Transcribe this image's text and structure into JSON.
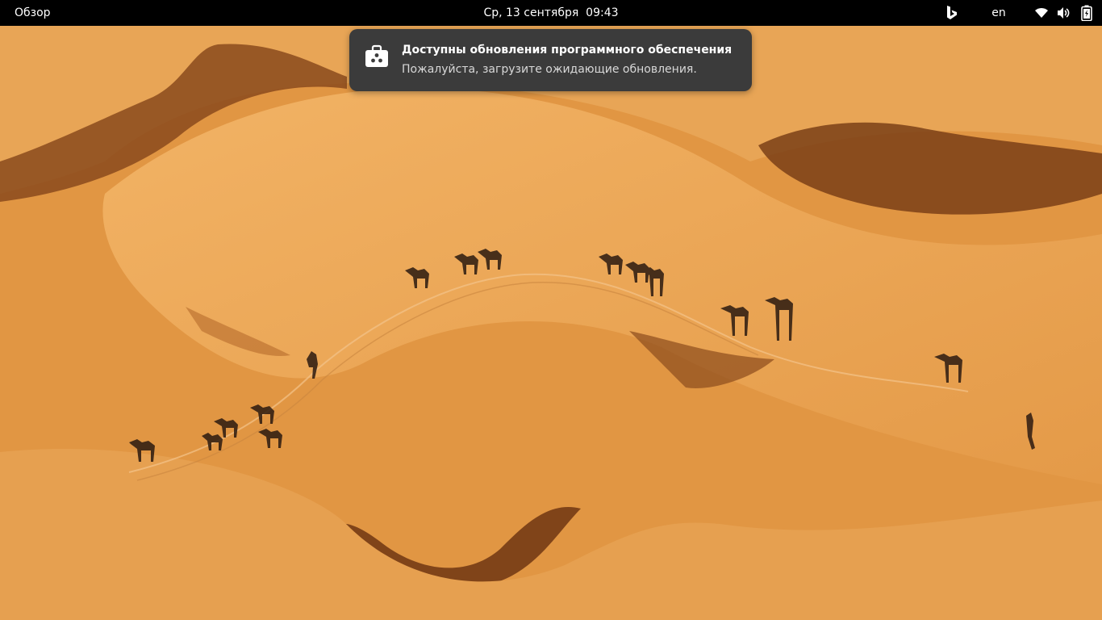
{
  "topbar": {
    "activities_label": "Обзор",
    "clock_date": "Ср, 13 сентября",
    "clock_time": "09:43",
    "keyboard_layout": "en",
    "tray_icons": [
      "bing-icon",
      "wifi-icon",
      "volume-icon",
      "battery-icon"
    ]
  },
  "notification": {
    "icon": "software-center-icon",
    "title": "Доступны обновления программного обеспечения",
    "body": "Пожалуйста, загрузите ожидающие обновления."
  },
  "desktop": {
    "wallpaper": "desert-dunes-camels",
    "colors": {
      "sand": "#e39a48",
      "shadow": "#7a3f16",
      "topbar": "#000000",
      "notification_bg": "#3b3b3b"
    }
  }
}
